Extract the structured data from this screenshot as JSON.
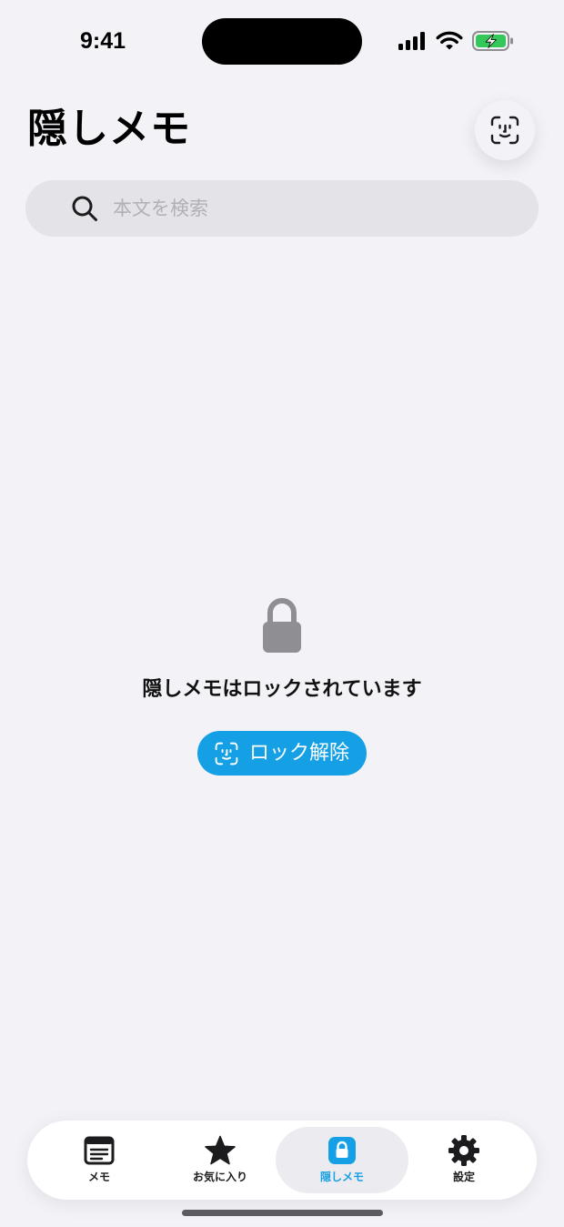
{
  "status_bar": {
    "time": "9:41"
  },
  "header": {
    "title": "隠しメモ",
    "faceid_button_icon": "faceid-icon"
  },
  "search": {
    "placeholder": "本文を検索",
    "value": "",
    "icon": "search-icon"
  },
  "locked_state": {
    "icon": "lock-icon",
    "message": "隠しメモはロックされています",
    "unlock_button": {
      "label": "ロック解除",
      "icon": "faceid-icon",
      "color": "#15a0e6"
    }
  },
  "tabbar": {
    "active_index": 2,
    "items": [
      {
        "label": "メモ",
        "icon": "note-icon"
      },
      {
        "label": "お気に入り",
        "icon": "star-icon"
      },
      {
        "label": "隠しメモ",
        "icon": "lock-icon"
      },
      {
        "label": "設定",
        "icon": "gear-icon"
      }
    ]
  },
  "colors": {
    "accent": "#15a0e6",
    "background": "#f2f2f7",
    "battery_green": "#34c759"
  }
}
